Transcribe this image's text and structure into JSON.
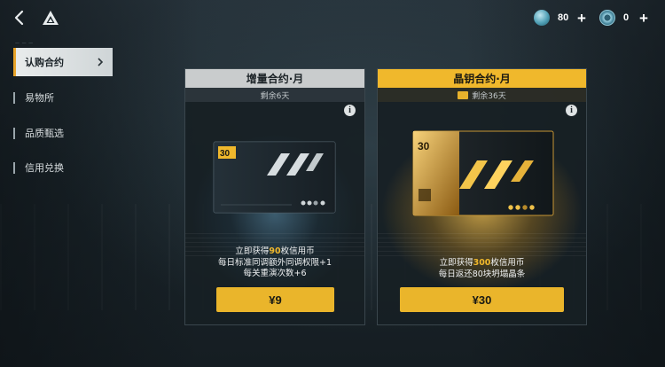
{
  "topbar": {
    "currency_a": {
      "icon": "crystal-coin-icon",
      "value": "80"
    },
    "currency_b": {
      "icon": "credit-coin-icon",
      "value": "0"
    },
    "plus": "+"
  },
  "sidebar": {
    "items": [
      {
        "label": "认购合约",
        "active": true
      },
      {
        "label": "易物所"
      },
      {
        "label": "品质甄选"
      },
      {
        "label": "信用兑换"
      }
    ]
  },
  "cards": [
    {
      "title": "增量合约·月",
      "remaining": "剩余6天",
      "card_days": "30",
      "desc_prefix": "立即获得",
      "desc_amount": "90",
      "desc_suffix": "枚信用币",
      "desc_line2": "每日标准同调额外同调权限+1",
      "desc_line3": "每关重演次数+6",
      "price": "¥9"
    },
    {
      "title": "晶钥合约·月",
      "remaining": "剩余36天",
      "card_days": "30",
      "desc_prefix": "立即获得",
      "desc_amount": "300",
      "desc_suffix": "枚信用币",
      "desc_line2": "每日返还80块坍塌晶条",
      "price": "¥30"
    }
  ],
  "colors": {
    "accent": "#f0b82c",
    "silver": "#c9cccd"
  }
}
